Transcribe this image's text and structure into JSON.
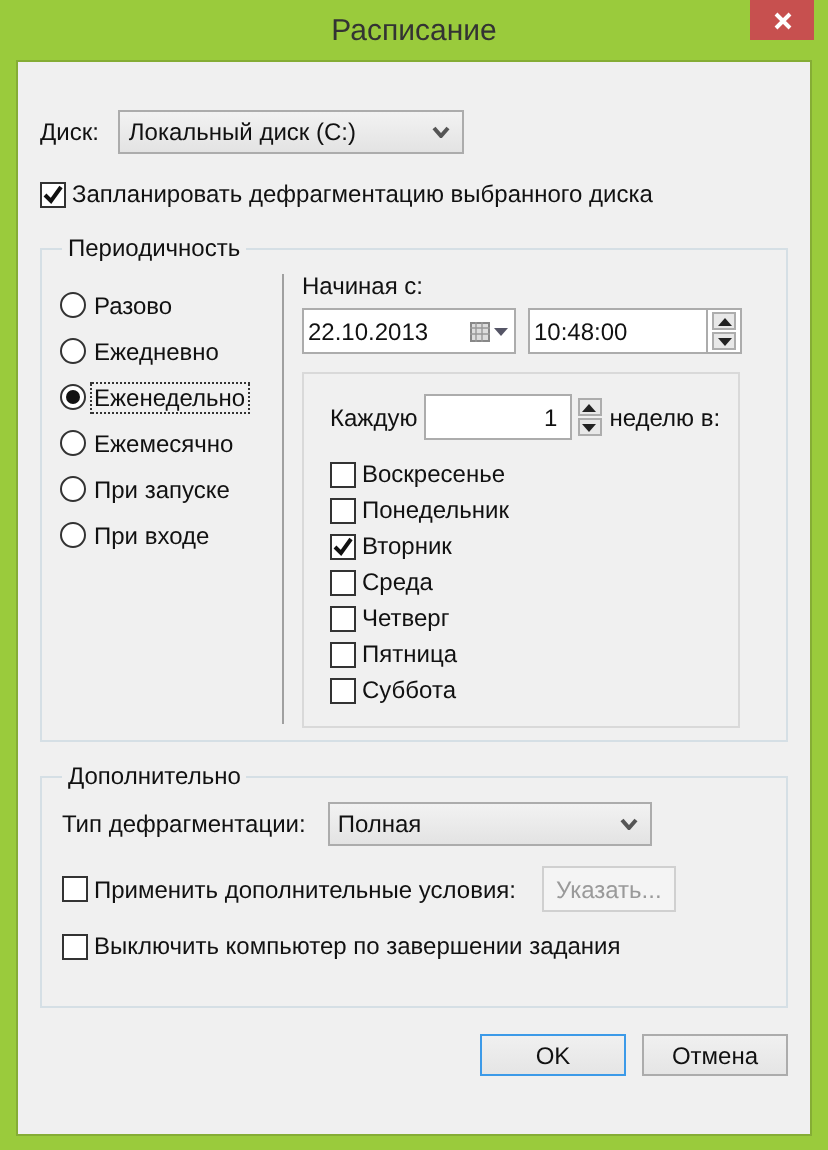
{
  "window": {
    "title": "Расписание"
  },
  "disk": {
    "label": "Диск:",
    "value": "Локальный диск (C:)"
  },
  "schedule_checkbox": {
    "label": "Запланировать дефрагментацию выбранного диска",
    "checked": true
  },
  "frequency": {
    "title": "Периодичность",
    "options": [
      {
        "label": "Разово",
        "selected": false
      },
      {
        "label": "Ежедневно",
        "selected": false
      },
      {
        "label": "Еженедельно",
        "selected": true
      },
      {
        "label": "Ежемесячно",
        "selected": false
      },
      {
        "label": "При запуске",
        "selected": false
      },
      {
        "label": "При входе",
        "selected": false
      }
    ]
  },
  "start": {
    "label": "Начиная с:",
    "date": "22.10.2013",
    "time": "10:48:00"
  },
  "weekly": {
    "every_label": "Каждую",
    "every_value": "1",
    "unit_label": "неделю в:",
    "days": [
      {
        "label": "Воскресенье",
        "checked": false
      },
      {
        "label": "Понедельник",
        "checked": false
      },
      {
        "label": "Вторник",
        "checked": true
      },
      {
        "label": "Среда",
        "checked": false
      },
      {
        "label": "Четверг",
        "checked": false
      },
      {
        "label": "Пятница",
        "checked": false
      },
      {
        "label": "Суббота",
        "checked": false
      }
    ]
  },
  "additional": {
    "title": "Дополнительно",
    "type_label": "Тип дефрагментации:",
    "type_value": "Полная",
    "conditions": {
      "label": "Применить дополнительные условия:",
      "checked": false
    },
    "specify_button": {
      "label": "Указать...",
      "disabled": true
    },
    "shutdown": {
      "label": "Выключить компьютер по завершении задания",
      "checked": false
    }
  },
  "buttons": [
    {
      "label": "OK",
      "default": true
    },
    {
      "label": "Отмена",
      "default": false
    }
  ]
}
